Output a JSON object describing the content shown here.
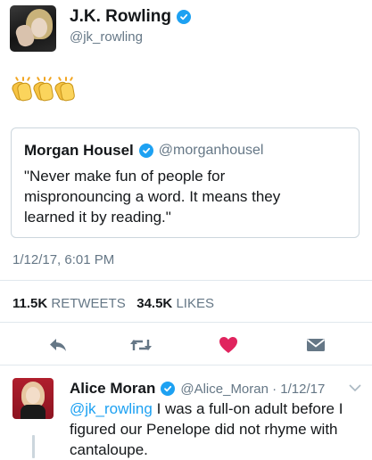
{
  "tweet": {
    "author_name": "J.K. Rowling",
    "author_handle": "@jk_rowling",
    "body_icon": "clapping-hands-emoji",
    "timestamp": "1/12/17, 6:01 PM",
    "retweets_count": "11.5K",
    "retweets_label": "RETWEETS",
    "likes_count": "34.5K",
    "likes_label": "LIKES",
    "accent": "#1da1f2",
    "like_color": "#e0245e"
  },
  "quoted": {
    "author_name": "Morgan Housel",
    "author_handle": "@morganhousel",
    "text": "\"Never make fun of people for mispronouncing a word. It means they learned it by reading.\""
  },
  "actions": [
    {
      "name": "reply",
      "icon": "reply-icon"
    },
    {
      "name": "retweet",
      "icon": "retweet-icon"
    },
    {
      "name": "like",
      "icon": "heart-icon"
    },
    {
      "name": "message",
      "icon": "envelope-icon"
    }
  ],
  "reply": {
    "author_name": "Alice Moran",
    "author_handle": "@Alice_Moran · 1/12/17",
    "mention": "@jk_rowling",
    "text": " I was a full-on adult before I figured our Penelope did not rhyme with cantaloupe."
  }
}
